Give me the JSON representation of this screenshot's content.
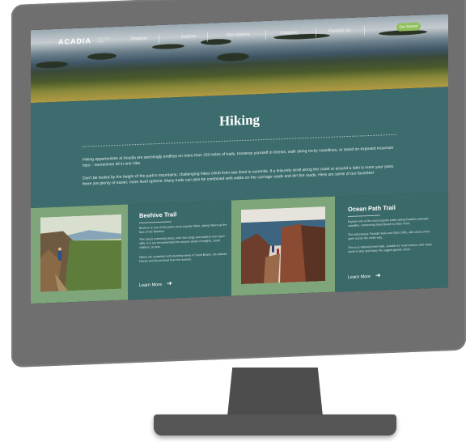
{
  "site": {
    "logo": "ACADIA",
    "logo_sub": "NATIONAL PARK"
  },
  "nav": {
    "items": [
      "Register",
      "Explore",
      "Our Visitors",
      "Camping",
      "Contact Us"
    ],
    "cta": "Get Started"
  },
  "page": {
    "title": "Hiking",
    "intro_1": "Hiking opportunities at Acadia are seemingly endless on more than 150 miles of trails. Immerse yourself in forests, walk along rocky coastlines, or stand on exposed mountain tops – sometimes all in one hike.",
    "intro_2": "Don't be fooled by the height of the park's mountains; challenging hikes climb from sea level to summits. If a leisurely stroll along the coast or around a lake is more your pace, there are plenty of easier, more level options. Many trails can also be combined with walks on the carriage roads and dirt fire roads. Here are some of our favorites!"
  },
  "cards": [
    {
      "title": "Beehive Trail",
      "text_1": "Beehive is one of the park's most popular hikes, taking hikers up the face of the Beehive.",
      "text_2": "This trail is extremely steep, with iron rungs and ladders over open cliffs. It is not recommended for anyone afraid of heights, small children, or pets.",
      "text_3": "Hikers are rewarded with stunning views of Sand Beach, the Atlantic Ocean and Great Head from the summit.",
      "learn_more": "Learn More"
    },
    {
      "title": "Ocean Path Trail",
      "text_1": "Explore one of the most popular paths along Acadia's dramatic coastline, connecting Sand Beach to Otter Point.",
      "text_2": "The trail passes Thunder Hole and Otter Cliffs, with views of the open ocean the entire way.",
      "text_3": "This is a relatively level walk, suitable for most visitors, with many spots to stop and enjoy the rugged granite shore.",
      "learn_more": "Learn More"
    }
  ],
  "colors": {
    "band": "#3c6c6d",
    "card_media": "#7fa67a",
    "cta": "#8fc05a"
  }
}
